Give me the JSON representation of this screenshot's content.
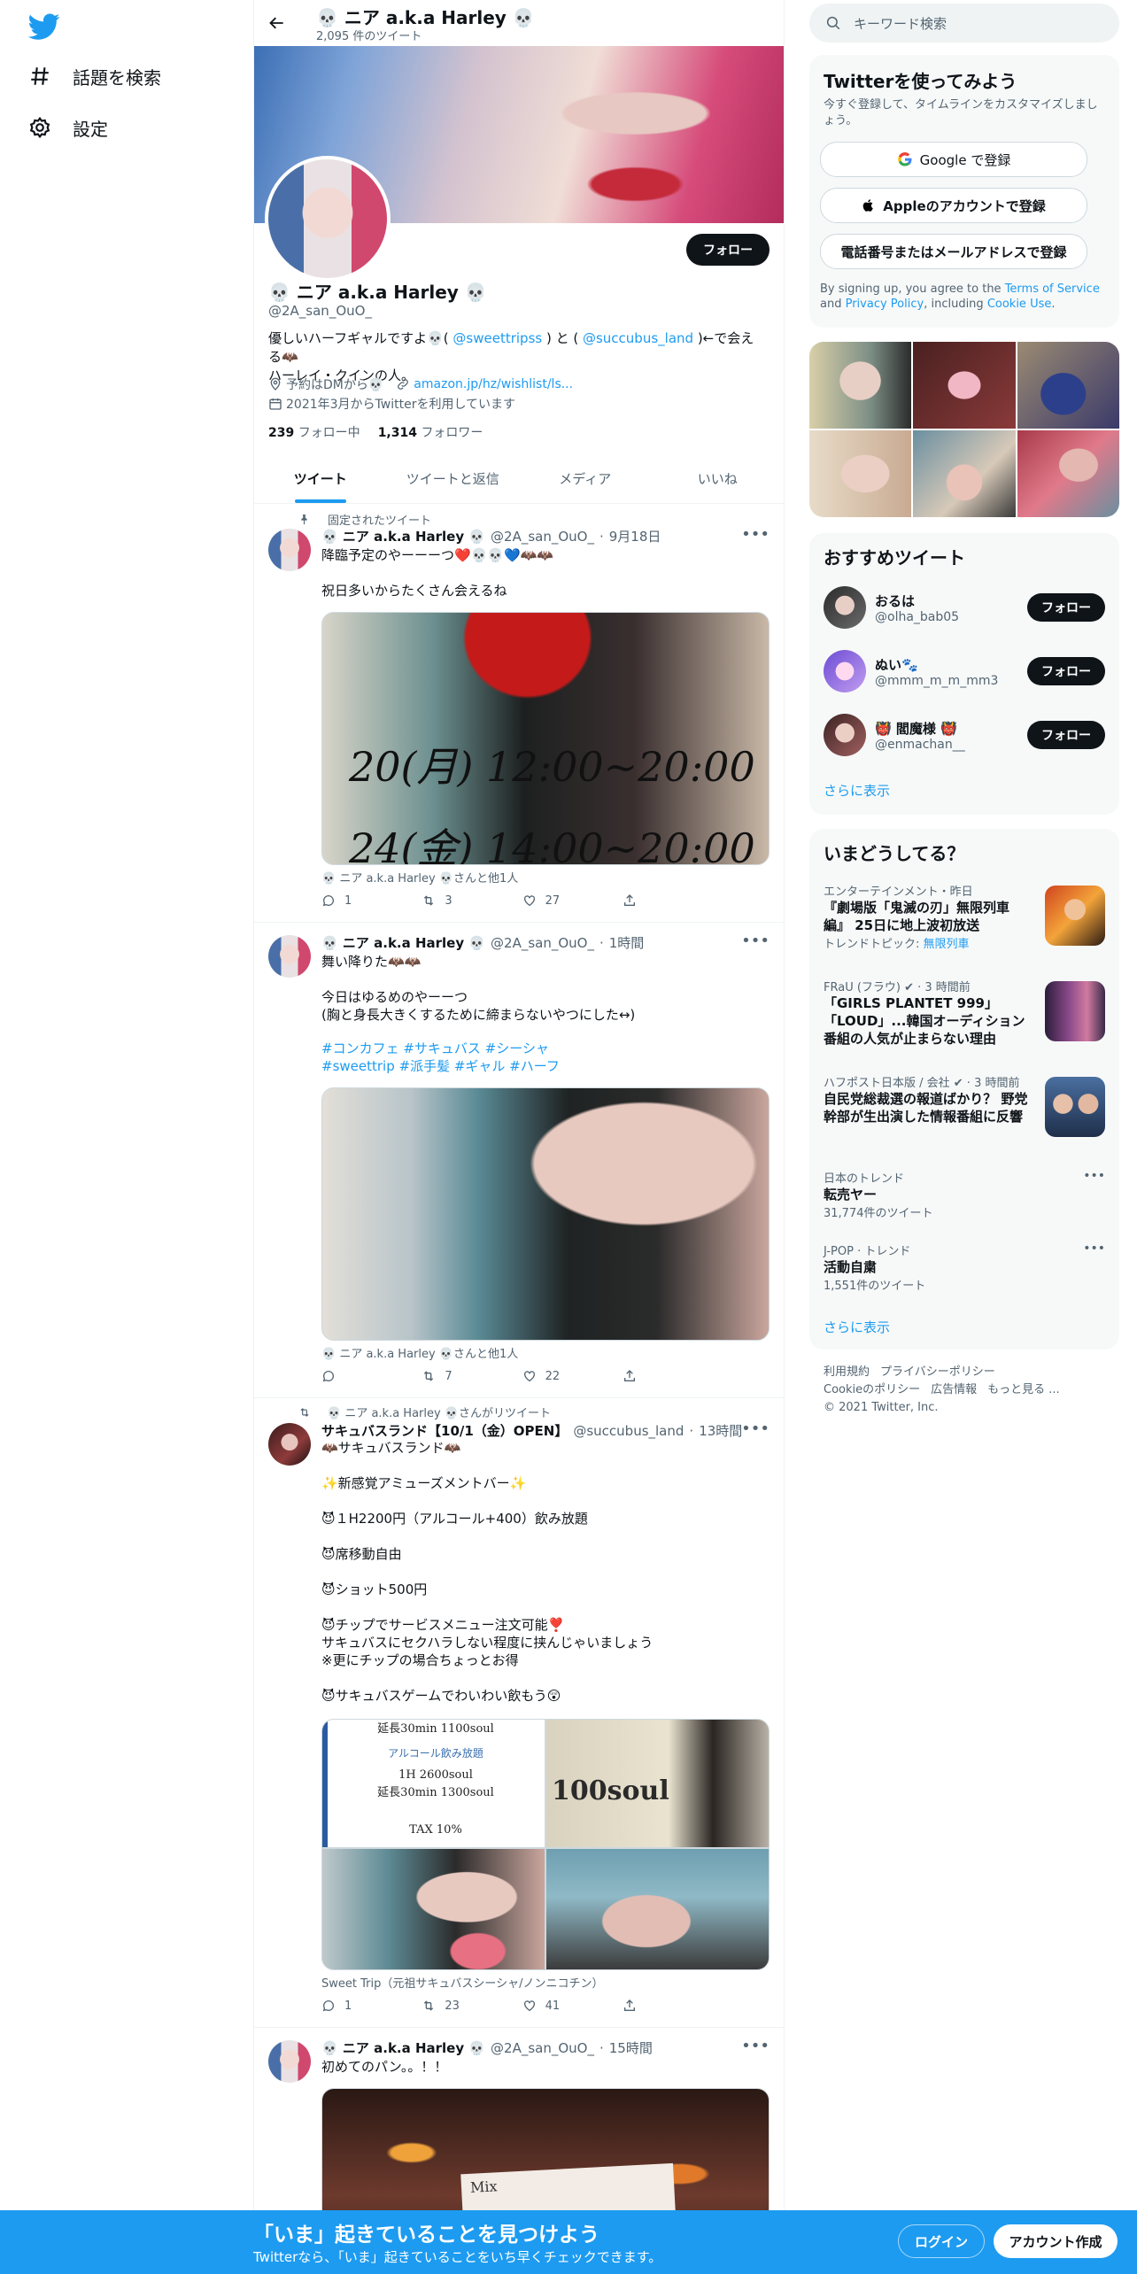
{
  "nav": {
    "explore_label": "話題を検索",
    "settings_label": "設定"
  },
  "profile": {
    "name": "💀 ニア a.k.a Harley 💀",
    "tweet_count": "2,095 件のツイート",
    "handle": "@2A_san_OuO_",
    "follow_label": "フォロー",
    "bio_line1_a": "優しいハーフギャルですよ💀( ",
    "bio_mention1": "@sweettripss",
    "bio_line1_b": " ) と ( ",
    "bio_mention2": "@succubus_land",
    "bio_line1_c": " )←で会える🦇",
    "bio_line2": "ハーレイ・クインの人。",
    "location": "予約はDMから💀",
    "link": "amazon.jp/hz/wishlist/ls...",
    "joined": "2021年3月からTwitterを利用しています",
    "following_count": "239",
    "following_label": "フォロー中",
    "followers_count": "1,314",
    "followers_label": "フォロワー"
  },
  "tabs": [
    "ツイート",
    "ツイートと返信",
    "メディア",
    "いいね"
  ],
  "tweets": [
    {
      "social": "固定されたツイート",
      "name": "💀 ニア a.k.a Harley 💀",
      "handle": "@2A_san_OuO_",
      "time": "9月18日",
      "text": "降臨予定のやーーーつ❤️💀💀💙🦇🦇\n\n祝日多いからたくさん会えるね",
      "media_text_1": "20(月) 12:00~20:00",
      "media_text_2": "24(金) 14:00~20:00",
      "tag": "💀 ニア a.k.a Harley 💀さんと他1人",
      "replies": "1",
      "retweets": "3",
      "likes": "27"
    },
    {
      "name": "💀 ニア a.k.a Harley 💀",
      "handle": "@2A_san_OuO_",
      "time": "1時間",
      "text": "舞い降りた🦇🦇\n\n今日はゆるめのやーーつ\n(胸と身長大きくするために締まらないやつにした↔)",
      "hashtags_1": "#コンカフェ #サキュバス #シーシャ",
      "hashtags_2": "#sweettrip #派手髪 #ギャル #ハーフ",
      "tag": "💀 ニア a.k.a Harley 💀さんと他1人",
      "replies": "",
      "retweets": "7",
      "likes": "22"
    },
    {
      "social": "💀 ニア a.k.a Harley 💀さんがリツイート",
      "name": "サキュバスランド【10/1（金）OPEN】",
      "handle": "@succubus_land",
      "time": "13時間",
      "text": "🦇サキュバスランド🦇\n\n✨新感覚アミューズメントバー✨\n\n😈１H2200円（アルコール+400）飲み放題\n\n😈席移動自由\n\n😈ショット500円\n\n😈チップでサービスメニュー注文可能❣️\nサキュバスにセクハラしない程度に挟んじゃいましょう\n※更にチップの場合ちょっとお得\n\n😈サキュバスゲームでわいわい飲もう😲",
      "menu_lines": [
        "延長30min 1100soul",
        "アルコール飲み放題",
        "1H 2600soul",
        "延長30min 1300soul",
        "TAX 10%"
      ],
      "money_text": "100soul",
      "tag": "Sweet Trip（元祖サキュバスシーシャ/ノンニコチン）",
      "replies": "1",
      "retweets": "23",
      "likes": "41"
    },
    {
      "name": "💀 ニア a.k.a Harley 💀",
      "handle": "@2A_san_OuO_",
      "time": "15時間",
      "text": "初めてのパン。。！！",
      "media_text_1": "Mix"
    }
  ],
  "right": {
    "search_placeholder": "キーワード検索",
    "signup": {
      "title": "Twitterを使ってみよう",
      "subtitle": "今すぐ登録して、タイムラインをカスタマイズしましょう。",
      "google": "Google で登録",
      "apple": "Appleのアカウントで登録",
      "phone": "電話番号またはメールアドレスで登録",
      "terms_a": "By signing up, you agree to the ",
      "terms_link1": "Terms of Service",
      "terms_b": " and ",
      "terms_link2": "Privacy Policy",
      "terms_c": ", including ",
      "terms_link3": "Cookie Use",
      "terms_d": "."
    },
    "recommend": {
      "title": "おすすめツイート",
      "users": [
        {
          "name": "おるは",
          "handle": "@olha_bab05",
          "button": "フォロー"
        },
        {
          "name": "ぬい🐾",
          "handle": "@mmm_m_m_mm3",
          "button": "フォロー"
        },
        {
          "name": "👹 閻魔様 👹",
          "handle": "@enmachan__",
          "button": "フォロー"
        }
      ],
      "show_more": "さらに表示"
    },
    "trends": {
      "title": "いまどうしてる？",
      "items": [
        {
          "meta": "エンターテインメント・昨日",
          "title": "『劇場版「鬼滅の刃」無限列車編』 25日に地上波初放送",
          "sub_a": "トレンドトピック: ",
          "sub_link": "無限列車"
        },
        {
          "meta": "FRaU (フラウ) ✔ · 3 時間前",
          "title": "「GIRLS PLANTET 999」「LOUD」...韓国オーディション番組の人気が止まらない理由"
        },
        {
          "meta": "ハフポスト日本版 / 会社 ✔ · 3 時間前",
          "title": "自民党総裁選の報道ばかり？ 野党幹部が生出演した情報番組に反響"
        },
        {
          "meta": "日本のトレンド",
          "title": "転売ヤー",
          "sub": "31,774件のツイート"
        },
        {
          "meta": "J-POP · トレンド",
          "title": "活動自粛",
          "sub": "1,551件のツイート"
        }
      ],
      "show_more": "さらに表示"
    },
    "footer": {
      "links": [
        "利用規約",
        "プライバシーポリシー",
        "Cookieのポリシー",
        "広告情報",
        "もっと見る ..."
      ],
      "copyright": "© 2021 Twitter, Inc."
    }
  },
  "bottom": {
    "title": "「いま」起きていることを見つけよう",
    "subtitle": "Twitterなら、「いま」起きていることをいち早くチェックできます。",
    "login": "ログイン",
    "signup": "アカウント作成"
  }
}
